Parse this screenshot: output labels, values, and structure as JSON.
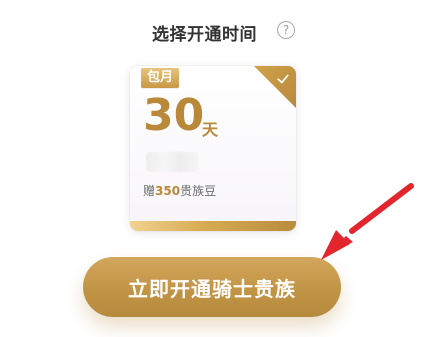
{
  "header": {
    "title": "选择开通时间",
    "help_icon": "question-circle-icon",
    "help_symbol": "?"
  },
  "plan": {
    "badge": "包月",
    "days_value": "30",
    "days_unit": "天",
    "bonus_prefix": "赠",
    "bonus_amount": "350",
    "bonus_suffix": "贵族豆",
    "selected": true,
    "selected_icon": "check-icon"
  },
  "cta": {
    "label": "立即开通骑士贵族"
  },
  "colors": {
    "gold": "#b98838",
    "gold_light": "#d2a65d",
    "arrow_red": "#e3262d"
  }
}
